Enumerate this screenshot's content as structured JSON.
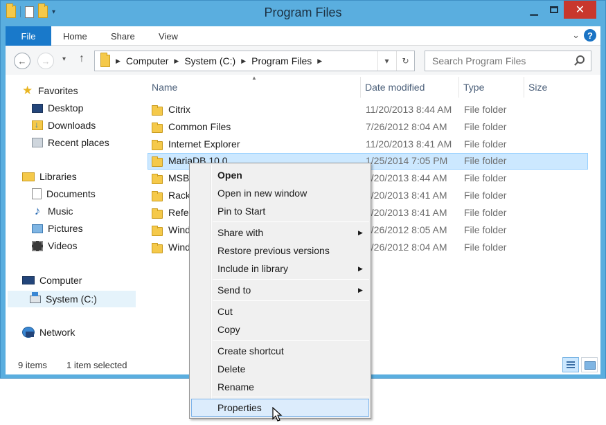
{
  "window": {
    "title": "Program Files"
  },
  "ribbon": {
    "tabs": [
      "File",
      "Home",
      "Share",
      "View"
    ]
  },
  "address": {
    "crumbs": [
      "Computer",
      "System (C:)",
      "Program Files"
    ],
    "search_placeholder": "Search Program Files"
  },
  "navpane": {
    "favorites": "Favorites",
    "desktop": "Desktop",
    "downloads": "Downloads",
    "recent": "Recent places",
    "libraries": "Libraries",
    "documents": "Documents",
    "music": "Music",
    "pictures": "Pictures",
    "videos": "Videos",
    "computer": "Computer",
    "system_c": "System (C:)",
    "network": "Network"
  },
  "columns": {
    "name": "Name",
    "date": "Date modified",
    "type": "Type",
    "size": "Size"
  },
  "files": [
    {
      "name": "Citrix",
      "date": "11/20/2013 8:44 AM",
      "type": "File folder"
    },
    {
      "name": "Common Files",
      "date": "7/26/2012 8:04 AM",
      "type": "File folder"
    },
    {
      "name": "Internet Explorer",
      "date": "11/20/2013 8:41 AM",
      "type": "File folder"
    },
    {
      "name": "MariaDB 10.0",
      "date": "1/25/2014 7:05 PM",
      "type": "File folder"
    },
    {
      "name": "MSB",
      "date": "1/20/2013 8:44 AM",
      "type": "File folder"
    },
    {
      "name": "Rack",
      "date": "1/20/2013 8:41 AM",
      "type": "File folder"
    },
    {
      "name": "Refer",
      "date": "1/20/2013 8:41 AM",
      "type": "File folder"
    },
    {
      "name": "Wind",
      "date": "7/26/2012 8:05 AM",
      "type": "File folder"
    },
    {
      "name": "Wind",
      "date": "7/26/2012 8:04 AM",
      "type": "File folder"
    }
  ],
  "status": {
    "count": "9 items",
    "selected": "1 item selected"
  },
  "context_menu": {
    "open": "Open",
    "open_new_window": "Open in new window",
    "pin_to_start": "Pin to Start",
    "share_with": "Share with",
    "restore_versions": "Restore previous versions",
    "include_library": "Include in library",
    "send_to": "Send to",
    "cut": "Cut",
    "copy": "Copy",
    "create_shortcut": "Create shortcut",
    "delete": "Delete",
    "rename": "Rename",
    "properties": "Properties"
  }
}
